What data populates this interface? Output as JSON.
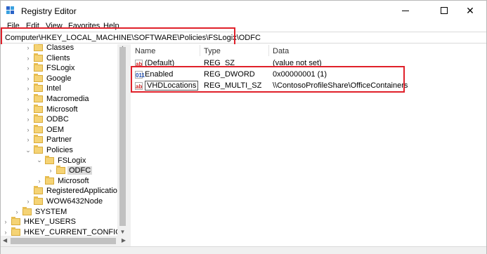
{
  "window": {
    "title": "Registry Editor",
    "icon": "regedit-icon",
    "controls": {
      "minimize": "minimize-icon",
      "maximize": "maximize-icon",
      "close": "✕"
    }
  },
  "menu": [
    "File",
    "Edit",
    "View",
    "Favorites",
    "Help"
  ],
  "address": "Computer\\HKEY_LOCAL_MACHINE\\SOFTWARE\\Policies\\FSLogix\\ODFC",
  "tree": [
    {
      "label": "Classes",
      "expander": "›",
      "depth": 3
    },
    {
      "label": "Clients",
      "expander": "›",
      "depth": 3
    },
    {
      "label": "FSLogix",
      "expander": "›",
      "depth": 3
    },
    {
      "label": "Google",
      "expander": "›",
      "depth": 3
    },
    {
      "label": "Intel",
      "expander": "›",
      "depth": 3
    },
    {
      "label": "Macromedia",
      "expander": "›",
      "depth": 3
    },
    {
      "label": "Microsoft",
      "expander": "›",
      "depth": 3
    },
    {
      "label": "ODBC",
      "expander": "›",
      "depth": 3
    },
    {
      "label": "OEM",
      "expander": "›",
      "depth": 3
    },
    {
      "label": "Partner",
      "expander": "›",
      "depth": 3
    },
    {
      "label": "Policies",
      "expander": "⌄",
      "depth": 3
    },
    {
      "label": "FSLogix",
      "expander": "⌄",
      "depth": 4
    },
    {
      "label": "ODFC",
      "expander": "›",
      "depth": 5,
      "selected": true
    },
    {
      "label": "Microsoft",
      "expander": "›",
      "depth": 4
    },
    {
      "label": "RegisteredApplications",
      "expander": "",
      "depth": 3
    },
    {
      "label": "WOW6432Node",
      "expander": "›",
      "depth": 3
    },
    {
      "label": "SYSTEM",
      "expander": "›",
      "depth": 2
    },
    {
      "label": "HKEY_USERS",
      "expander": "›",
      "depth": 1
    },
    {
      "label": "HKEY_CURRENT_CONFIG",
      "expander": "›",
      "depth": 1
    }
  ],
  "columns": [
    "Name",
    "Type",
    "Data"
  ],
  "values": [
    {
      "icon": "ab",
      "kind": "sz",
      "name": "(Default)",
      "type": "REG_SZ",
      "data": "(value not set)"
    },
    {
      "icon": "011",
      "kind": "dw",
      "name": "Enabled",
      "type": "REG_DWORD",
      "data": "0x00000001 (1)"
    },
    {
      "icon": "ab",
      "kind": "sz",
      "name": "VHDLocations",
      "type": "REG_MULTI_SZ",
      "data": "\\\\ContosoProfileShare\\OfficeContainers",
      "editing": true
    }
  ],
  "colors": {
    "highlight": "#e0202a",
    "folder": "#f5d375",
    "selection": "#d9d9d9"
  }
}
